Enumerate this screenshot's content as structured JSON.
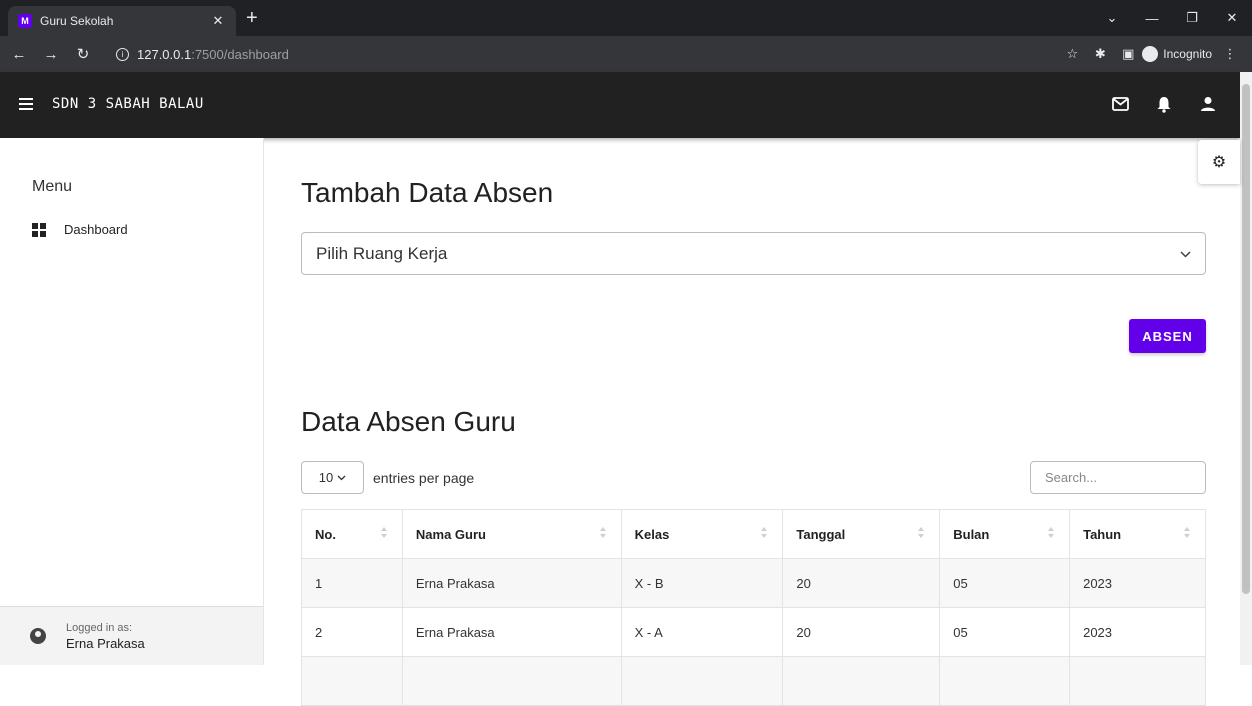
{
  "browser": {
    "tab_title": "Guru Sekolah",
    "url_host": "127.0.0.1",
    "url_path": ":7500/dashboard",
    "incognito_label": "Incognito"
  },
  "header": {
    "brand": "SDN 3 SABAH BALAU"
  },
  "sidebar": {
    "menu_title": "Menu",
    "items": [
      {
        "label": "Dashboard",
        "icon": "grid-icon"
      }
    ],
    "logged_in_label": "Logged in as:",
    "user_name": "Erna Prakasa"
  },
  "main": {
    "title": "Tambah Data Absen",
    "select_value": "Pilih Ruang Kerja",
    "absen_button": "ABSEN",
    "table_title": "Data Absen Guru",
    "per_page_value": "10",
    "per_page_label": "entries per page",
    "search_placeholder": "Search...",
    "columns": [
      "No.",
      "Nama Guru",
      "Kelas",
      "Tanggal",
      "Bulan",
      "Tahun"
    ],
    "rows": [
      [
        "1",
        "Erna Prakasa",
        "X - B",
        "20",
        "05",
        "2023"
      ],
      [
        "2",
        "Erna Prakasa",
        "X - A",
        "20",
        "05",
        "2023"
      ]
    ]
  },
  "colors": {
    "accent": "#6200ea",
    "appbar": "#212121"
  }
}
